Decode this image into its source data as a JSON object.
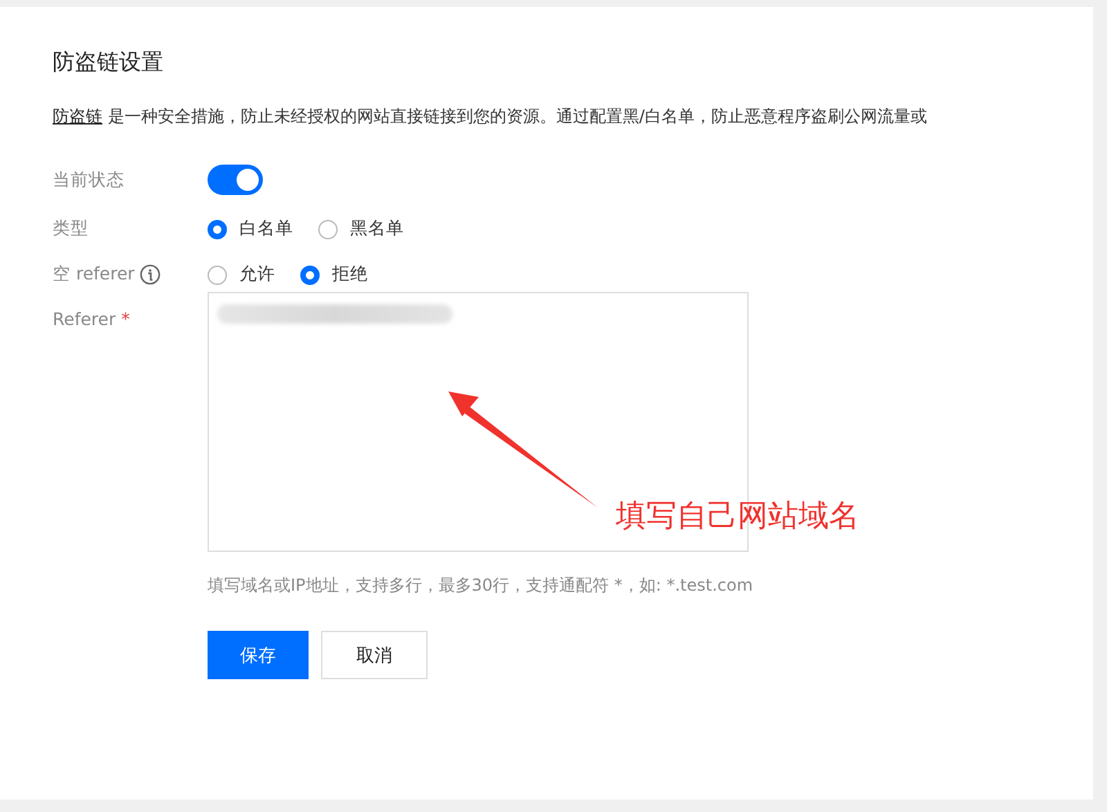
{
  "title": "防盗链设置",
  "description": {
    "link": "防盗链",
    "text": " 是一种安全措施，防止未经授权的网站直接链接到您的资源。通过配置黑/白名单，防止恶意程序盗刷公网流量或"
  },
  "status": {
    "label": "当前状态",
    "on": true
  },
  "type": {
    "label": "类型",
    "options": [
      {
        "label": "白名单",
        "selected": true
      },
      {
        "label": "黑名单",
        "selected": false
      }
    ]
  },
  "empty_referer": {
    "label": "空 referer",
    "options": [
      {
        "label": "允许",
        "selected": false
      },
      {
        "label": "拒绝",
        "selected": true
      }
    ]
  },
  "referer": {
    "label": "Referer",
    "required_mark": "*",
    "hint": "填写域名或IP地址，支持多行，最多30行，支持通配符 *，如: *.test.com"
  },
  "buttons": [
    {
      "label": "保存",
      "kind": "primary"
    },
    {
      "label": "取消",
      "kind": "default"
    }
  ],
  "annotation": "填写自己网站域名"
}
